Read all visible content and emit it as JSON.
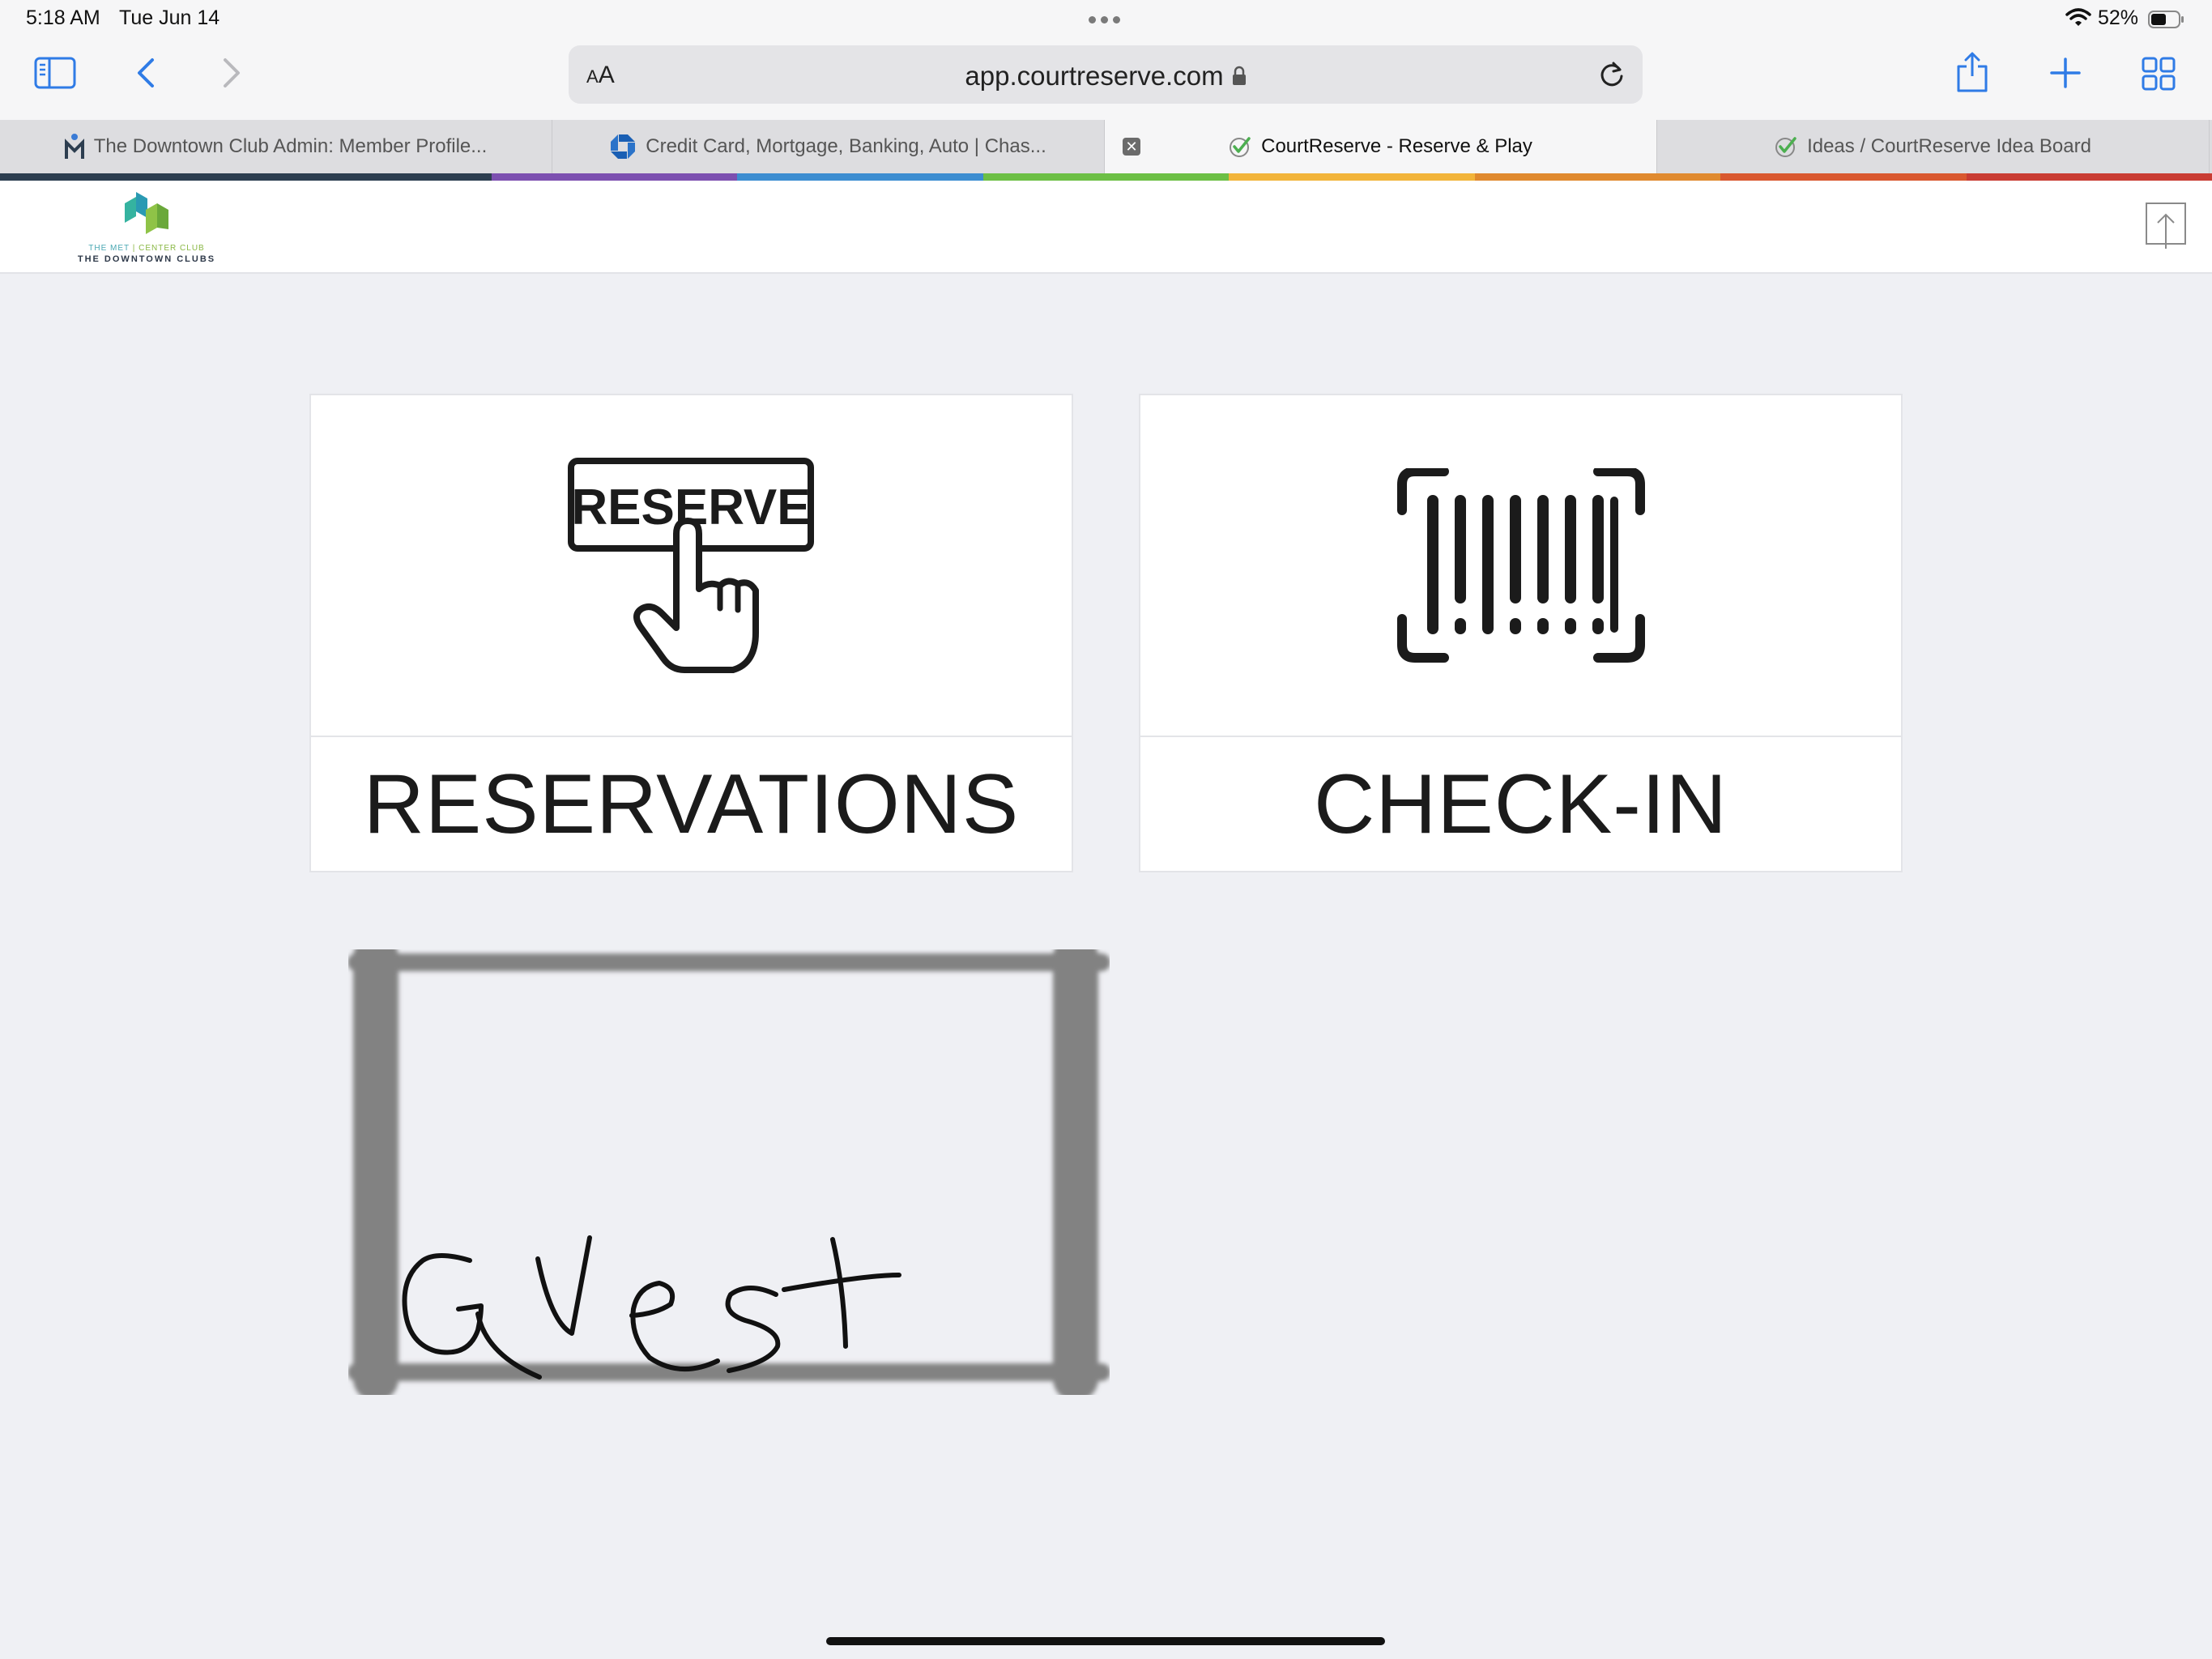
{
  "status": {
    "time": "5:18 AM",
    "date": "Tue Jun 14",
    "battery": "52%"
  },
  "browser": {
    "aa_label_small": "A",
    "aa_label_large": "A",
    "url": "app.courtreserve.com"
  },
  "tabs": [
    {
      "title": "The Downtown Club Admin: Member Profile...",
      "favicon": "m-person-icon"
    },
    {
      "title": "Credit Card, Mortgage, Banking, Auto | Chas...",
      "favicon": "chase-octagon-icon"
    },
    {
      "title": "CourtReserve - Reserve & Play",
      "favicon": "courtreserve-check-icon"
    },
    {
      "title": "Ideas / CourtReserve Idea Board",
      "favicon": "courtreserve-check-icon"
    }
  ],
  "tab_colors": [
    "#2d3e50",
    "#2d3e50",
    "#7c4fb0",
    "#3c8dd1",
    "#6cbf45",
    "#f2b43a",
    "#e08a2f",
    "#d9582f",
    "#c93c33"
  ],
  "logo": {
    "line1_left": "THE MET",
    "line1_sep": "|",
    "line1_right": "CENTER CLUB",
    "line2": "THE DOWNTOWN CLUBS"
  },
  "tiles": {
    "reservations": {
      "label": "RESERVATIONS",
      "icon_text": "RESERVE"
    },
    "checkin": {
      "label": "CHECK-IN"
    }
  },
  "handwritten_note": "Guest"
}
